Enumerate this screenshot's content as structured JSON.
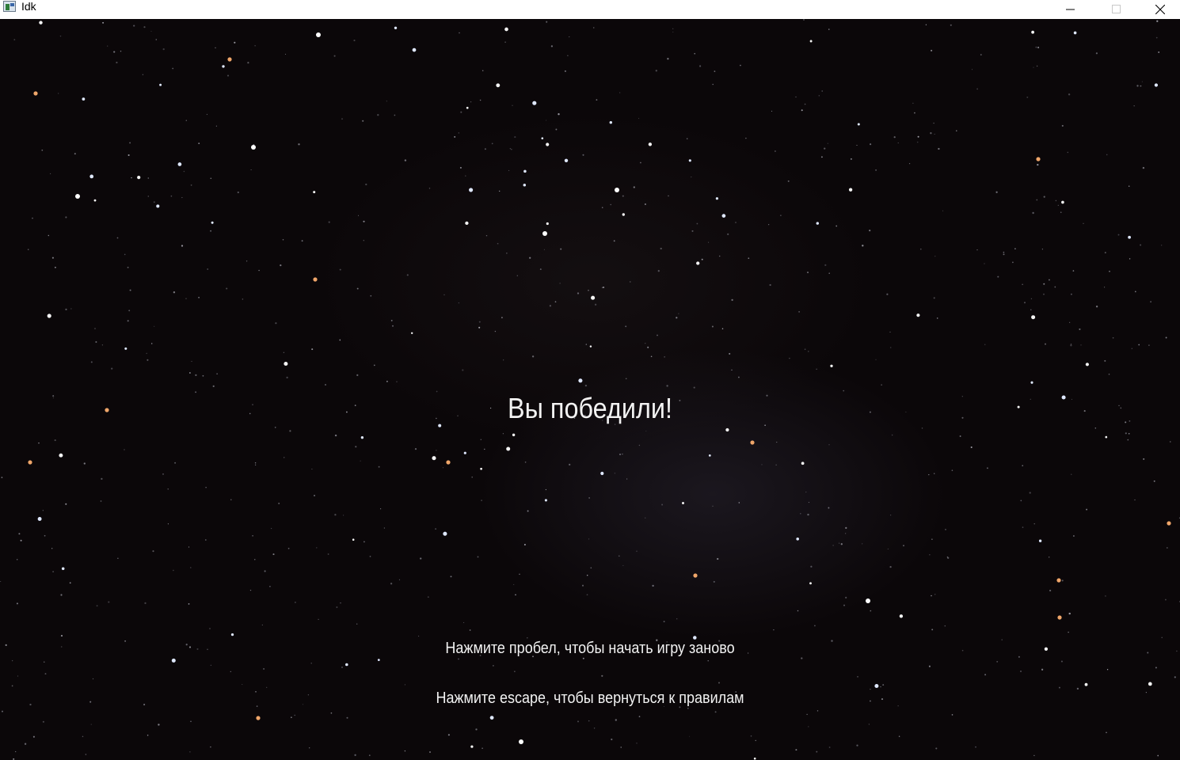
{
  "window": {
    "title": "Idk",
    "controls": [
      "minimize-icon",
      "maximize-icon",
      "close-icon"
    ]
  },
  "game": {
    "background": "starry-night-sky",
    "colors": {
      "sky": "#0b0709",
      "text": "#f2f2f2"
    },
    "result_title": "Вы победили!",
    "restart_hint": "Нажмите пробел, чтобы начать игру заново",
    "escape_hint": "Нажмите escape, чтобы вернуться к правилам"
  }
}
